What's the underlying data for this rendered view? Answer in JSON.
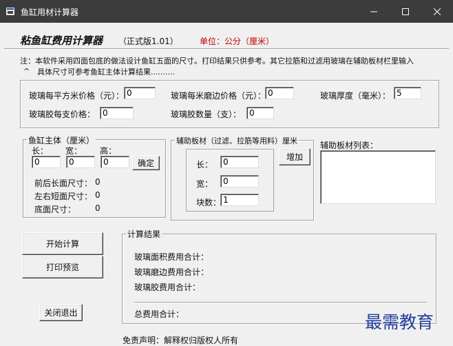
{
  "window": {
    "title": "鱼缸用材计算器"
  },
  "header": {
    "app_name": "粘鱼缸费用计算器",
    "version": "（正式版1.01）",
    "unit": "单位：公分（厘米）"
  },
  "notice": {
    "line1": "注：本软件采用四面包底的做法设计鱼缸五面的尺寸。打印结果只供参考。其它拉筋和过滤用玻璃在辅助板材栏里输入",
    "line2_mark": "^",
    "line2": "具体尺寸可参考鱼缸主体计算结果.........."
  },
  "prices": {
    "glass_price_label": "玻璃每平方米价格（元）：",
    "glass_price_value": "0",
    "edge_price_label": "玻璃每米磨边价格（元）：",
    "edge_price_value": "0",
    "thickness_label": "玻璃厚度（毫米）：",
    "thickness_value": "5",
    "glue_price_label": "玻璃胶每支价格：",
    "glue_price_value": "0",
    "glue_count_label": "玻璃胶数量（支）：",
    "glue_count_value": "0"
  },
  "tank": {
    "legend": "鱼缸主体（厘米）",
    "length_label": "长：",
    "width_label": "宽：",
    "height_label": "高：",
    "length_value": "0",
    "width_value": "0",
    "height_value": "0",
    "confirm_button": "确定",
    "front_back_label": "前后长面尺寸：",
    "front_back_value": "0",
    "left_right_label": "左右短面尺寸：",
    "left_right_value": "0",
    "bottom_label": "底面尺寸：",
    "bottom_value": "0"
  },
  "aux": {
    "legend": "辅助板材（过滤、拉筋等用料）厘米",
    "length_label": "长：",
    "length_value": "0",
    "width_label": "宽：",
    "width_value": "0",
    "count_label": "块数：",
    "count_value": "1",
    "add_button": "增加",
    "list_label": "辅助板材列表："
  },
  "actions": {
    "start_button": "开始计算",
    "preview_button": "打印预览",
    "exit_button": "关闭退出"
  },
  "results": {
    "legend": "计算结果",
    "area_cost_label": "玻璃面积费用合计：",
    "edge_cost_label": "玻璃磨边费用合计：",
    "glue_cost_label": "玻璃胶费用合计：",
    "total_label": "总费用合计："
  },
  "footer": {
    "disclaimer": "免责声明：解释权归版权人所有"
  },
  "watermark": {
    "text": "最需教育"
  },
  "colors": {
    "titlebar": "#3c3c3c",
    "unit_text": "#c00000",
    "watermark": "#1f3d9c",
    "client_bg": "#f0f0f0"
  }
}
